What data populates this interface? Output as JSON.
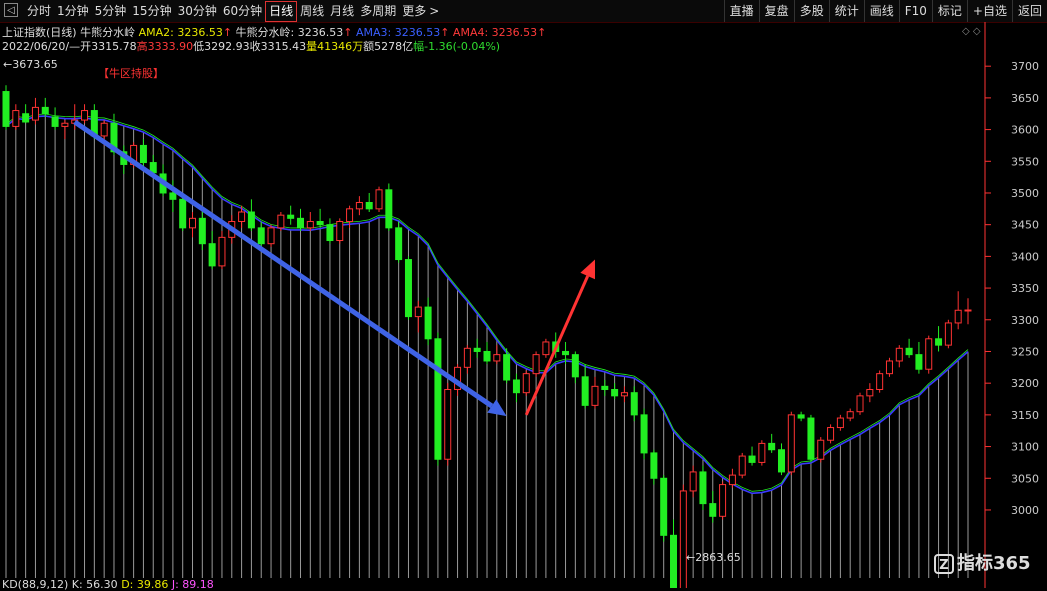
{
  "toolbar": {
    "back_icon": "back-icon",
    "tabs": [
      "分时",
      "1分钟",
      "5分钟",
      "15分钟",
      "30分钟",
      "60分钟",
      "日线",
      "周线",
      "月线",
      "多周期",
      "更多"
    ],
    "active_tab": "日线",
    "more_arrow": ">",
    "right_tools": [
      "直播",
      "复盘",
      "多股",
      "统计",
      "画线",
      "F10",
      "标记",
      "+自选",
      "返回"
    ]
  },
  "header": {
    "title": "上证指数(日线)",
    "indicator_name": "牛熊分水岭",
    "ama2": "AMA2: 3236.53",
    "indicator_name2": "牛熊分水岭: 3236.53",
    "ama3": "AMA3: 3236.53",
    "ama4": "AMA4: 3236.53",
    "up_arrow": "↑",
    "date": "2022/06/20/—",
    "open": "开3315.78",
    "high": "高3333.90",
    "low": "低3292.93",
    "close": "收3315.43",
    "volume": "量41346万",
    "amount": "额5278亿",
    "change": "幅-1.36(-0.04%)"
  },
  "annotations": {
    "high_label": "←3673.65",
    "low_label": "←2863.65",
    "bull_zone": "【牛区持股】"
  },
  "bottom": {
    "kd_name": "KD(88,9,12)",
    "k": "K: 56.30",
    "d": "D: 39.86",
    "j": "J: 89.18"
  },
  "watermark": {
    "logo": "Z",
    "text": "指标365"
  },
  "colors": {
    "background": "#000000",
    "up": "#ff3333",
    "down": "#22ee22",
    "ma_line": "#3a3aff",
    "hatch": "#9a9a9a",
    "axis": "#ff3333",
    "trend_down": "#3f63e6",
    "trend_up": "#ff3333"
  },
  "chart_data": {
    "type": "candlestick",
    "ylim": [
      2940,
      3735
    ],
    "yticks": [
      3000,
      3050,
      3100,
      3150,
      3200,
      3250,
      3300,
      3350,
      3400,
      3450,
      3500,
      3550,
      3600,
      3650,
      3700
    ],
    "annotations": [
      {
        "text": "←3673.65",
        "y": 3673.65,
        "type": "high"
      },
      {
        "text": "←2863.65",
        "y": 2863.65,
        "type": "low"
      },
      {
        "text": "【牛区持股】",
        "type": "label"
      }
    ],
    "trend_arrows": [
      {
        "color": "blue",
        "from": [
          7,
          3612
        ],
        "to": [
          51,
          3148
        ]
      },
      {
        "color": "red",
        "from": [
          53,
          3150
        ],
        "to": [
          60,
          3395
        ]
      }
    ],
    "candles": [
      [
        3660,
        3670,
        3600,
        3605
      ],
      [
        3605,
        3640,
        3600,
        3630
      ],
      [
        3625,
        3640,
        3610,
        3612
      ],
      [
        3615,
        3650,
        3608,
        3635
      ],
      [
        3635,
        3650,
        3620,
        3625
      ],
      [
        3620,
        3635,
        3600,
        3605
      ],
      [
        3605,
        3615,
        3585,
        3610
      ],
      [
        3610,
        3640,
        3600,
        3615
      ],
      [
        3615,
        3640,
        3610,
        3630
      ],
      [
        3630,
        3640,
        3585,
        3590
      ],
      [
        3590,
        3615,
        3575,
        3610
      ],
      [
        3610,
        3625,
        3560,
        3565
      ],
      [
        3565,
        3575,
        3530,
        3545
      ],
      [
        3545,
        3580,
        3540,
        3575
      ],
      [
        3575,
        3585,
        3540,
        3548
      ],
      [
        3548,
        3560,
        3530,
        3532
      ],
      [
        3530,
        3545,
        3495,
        3500
      ],
      [
        3500,
        3520,
        3470,
        3490
      ],
      [
        3490,
        3495,
        3440,
        3445
      ],
      [
        3445,
        3470,
        3430,
        3460
      ],
      [
        3460,
        3475,
        3410,
        3420
      ],
      [
        3420,
        3440,
        3380,
        3385
      ],
      [
        3385,
        3440,
        3380,
        3430
      ],
      [
        3430,
        3465,
        3420,
        3455
      ],
      [
        3455,
        3480,
        3445,
        3470
      ],
      [
        3470,
        3490,
        3440,
        3445
      ],
      [
        3445,
        3455,
        3415,
        3420
      ],
      [
        3420,
        3450,
        3415,
        3445
      ],
      [
        3445,
        3470,
        3440,
        3465
      ],
      [
        3465,
        3480,
        3450,
        3460
      ],
      [
        3460,
        3475,
        3440,
        3445
      ],
      [
        3445,
        3470,
        3440,
        3455
      ],
      [
        3455,
        3475,
        3445,
        3450
      ],
      [
        3450,
        3460,
        3420,
        3425
      ],
      [
        3425,
        3460,
        3420,
        3455
      ],
      [
        3455,
        3480,
        3445,
        3475
      ],
      [
        3475,
        3495,
        3465,
        3485
      ],
      [
        3485,
        3500,
        3470,
        3475
      ],
      [
        3475,
        3510,
        3470,
        3505
      ],
      [
        3505,
        3515,
        3440,
        3445
      ],
      [
        3445,
        3455,
        3390,
        3395
      ],
      [
        3395,
        3400,
        3300,
        3305
      ],
      [
        3305,
        3330,
        3280,
        3320
      ],
      [
        3320,
        3335,
        3260,
        3270
      ],
      [
        3270,
        3280,
        3070,
        3080
      ],
      [
        3080,
        3200,
        3070,
        3190
      ],
      [
        3190,
        3230,
        3180,
        3225
      ],
      [
        3225,
        3260,
        3215,
        3255
      ],
      [
        3255,
        3270,
        3240,
        3250
      ],
      [
        3250,
        3265,
        3230,
        3235
      ],
      [
        3235,
        3260,
        3230,
        3245
      ],
      [
        3245,
        3255,
        3200,
        3205
      ],
      [
        3205,
        3215,
        3170,
        3185
      ],
      [
        3185,
        3220,
        3180,
        3215
      ],
      [
        3215,
        3250,
        3210,
        3245
      ],
      [
        3245,
        3270,
        3240,
        3265
      ],
      [
        3265,
        3280,
        3240,
        3250
      ],
      [
        3250,
        3265,
        3230,
        3245
      ],
      [
        3245,
        3250,
        3200,
        3210
      ],
      [
        3210,
        3230,
        3160,
        3165
      ],
      [
        3165,
        3210,
        3160,
        3195
      ],
      [
        3195,
        3205,
        3180,
        3190
      ],
      [
        3190,
        3200,
        3175,
        3180
      ],
      [
        3180,
        3195,
        3170,
        3185
      ],
      [
        3185,
        3195,
        3140,
        3150
      ],
      [
        3150,
        3160,
        3080,
        3090
      ],
      [
        3090,
        3095,
        3040,
        3050
      ],
      [
        3050,
        3055,
        2950,
        2960
      ],
      [
        2960,
        2985,
        2860,
        2870
      ],
      [
        2870,
        3040,
        2865,
        3030
      ],
      [
        3030,
        3070,
        3020,
        3060
      ],
      [
        3060,
        3070,
        3000,
        3010
      ],
      [
        3010,
        3030,
        2980,
        2990
      ],
      [
        2990,
        3045,
        2985,
        3040
      ],
      [
        3040,
        3065,
        3035,
        3055
      ],
      [
        3055,
        3090,
        3050,
        3085
      ],
      [
        3085,
        3100,
        3070,
        3075
      ],
      [
        3075,
        3110,
        3070,
        3105
      ],
      [
        3105,
        3120,
        3090,
        3095
      ],
      [
        3095,
        3105,
        3055,
        3060
      ],
      [
        3060,
        3155,
        3055,
        3150
      ],
      [
        3150,
        3155,
        3140,
        3145
      ],
      [
        3145,
        3150,
        3075,
        3080
      ],
      [
        3080,
        3115,
        3075,
        3110
      ],
      [
        3110,
        3135,
        3105,
        3130
      ],
      [
        3130,
        3150,
        3125,
        3145
      ],
      [
        3145,
        3160,
        3140,
        3155
      ],
      [
        3155,
        3185,
        3150,
        3180
      ],
      [
        3180,
        3200,
        3170,
        3190
      ],
      [
        3190,
        3220,
        3185,
        3215
      ],
      [
        3215,
        3240,
        3210,
        3235
      ],
      [
        3235,
        3260,
        3225,
        3255
      ],
      [
        3255,
        3270,
        3240,
        3245
      ],
      [
        3245,
        3265,
        3215,
        3222
      ],
      [
        3222,
        3275,
        3215,
        3270
      ],
      [
        3270,
        3290,
        3250,
        3260
      ],
      [
        3260,
        3300,
        3255,
        3295
      ],
      [
        3295,
        3345,
        3285,
        3315
      ],
      [
        3315,
        3333.9,
        3292.93,
        3315.43
      ]
    ]
  }
}
